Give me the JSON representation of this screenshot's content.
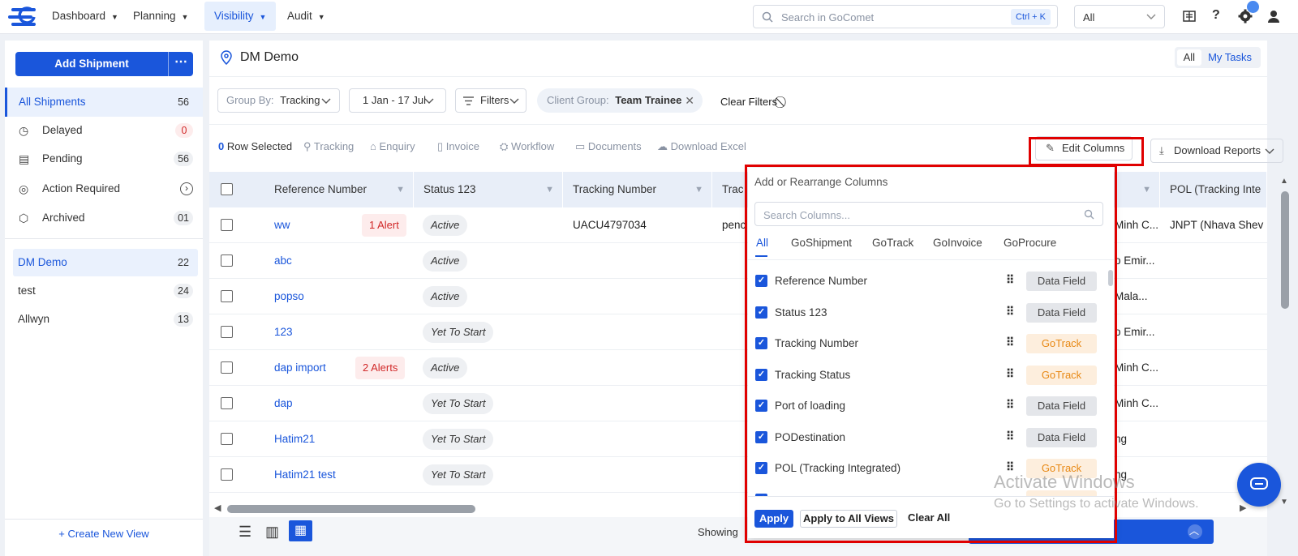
{
  "nav": {
    "items": [
      {
        "label": "Dashboard"
      },
      {
        "label": "Planning"
      },
      {
        "label": "Visibility"
      },
      {
        "label": "Audit"
      }
    ],
    "search_placeholder": "Search in GoComet",
    "search_shortcut": "Ctrl + K",
    "scope_select": "All"
  },
  "sidebar": {
    "add_shipment": "Add Shipment",
    "more": "⋯",
    "items": [
      {
        "label": "All Shipments",
        "count": "56"
      },
      {
        "label": "Delayed",
        "count": "0"
      },
      {
        "label": "Pending",
        "count": "56"
      },
      {
        "label": "Action Required",
        "count": "›"
      },
      {
        "label": "Archived",
        "count": "01"
      }
    ],
    "views": [
      {
        "label": "DM Demo",
        "count": "22"
      },
      {
        "label": "test",
        "count": "24"
      },
      {
        "label": "Allwyn",
        "count": "13"
      }
    ],
    "create_view": "+ Create New View"
  },
  "main": {
    "title": "DM Demo",
    "toggle_all": "All",
    "toggle_mytasks": "My Tasks",
    "group_by_label": "Group By:",
    "group_by_value": "Tracking",
    "date_range": "1 Jan - 17 Jul",
    "filters": "Filters",
    "client_group_label": "Client Group:",
    "client_group_value": "Team Trainee",
    "clear_filters": "Clear Filters",
    "rows_selected_count": "0",
    "rows_selected_label": "Row Selected",
    "actions": [
      "Tracking",
      "Enquiry",
      "Invoice",
      "Workflow",
      "Documents",
      "Download Excel"
    ],
    "edit_columns": "Edit Columns",
    "download_reports": "Download Reports"
  },
  "table": {
    "headers": [
      "Reference Number",
      "Status 123",
      "Tracking Number",
      "Trac",
      "",
      "POL (Tracking Inte"
    ],
    "rows": [
      {
        "ref": "ww",
        "alert": "1 Alert",
        "status": "Active",
        "tracking": "UACU4797034",
        "trac": "penc",
        "col5": "Minh C...",
        "pol": "JNPT (Nhava Shev"
      },
      {
        "ref": "abc",
        "alert": "",
        "status": "Active",
        "tracking": "",
        "trac": "",
        "col5": "o Emir...",
        "pol": ""
      },
      {
        "ref": "popso",
        "alert": "",
        "status": "Active",
        "tracking": "",
        "trac": "",
        "col5": "Mala...",
        "pol": ""
      },
      {
        "ref": "123",
        "alert": "",
        "status": "Yet To Start",
        "tracking": "",
        "trac": "",
        "col5": "o Emir...",
        "pol": ""
      },
      {
        "ref": "dap import",
        "alert": "2 Alerts",
        "status": "Active",
        "tracking": "",
        "trac": "",
        "col5": "Minh C...",
        "pol": ""
      },
      {
        "ref": "dap",
        "alert": "",
        "status": "Yet To Start",
        "tracking": "",
        "trac": "",
        "col5": "Minh C...",
        "pol": ""
      },
      {
        "ref": "Hatim21",
        "alert": "",
        "status": "Yet To Start",
        "tracking": "",
        "trac": "",
        "col5": "ng",
        "pol": ""
      },
      {
        "ref": "Hatim21 test",
        "alert": "",
        "status": "Yet To Start",
        "tracking": "",
        "trac": "",
        "col5": "ng",
        "pol": ""
      }
    ],
    "footer_showing": "Showing"
  },
  "edit_columns_popup": {
    "title": "Add or Rearrange Columns",
    "search_placeholder": "Search Columns...",
    "tabs": [
      "All",
      "GoShipment",
      "GoTrack",
      "GoInvoice",
      "GoProcure"
    ],
    "columns": [
      {
        "name": "Reference Number",
        "tag": "Data Field"
      },
      {
        "name": "Status 123",
        "tag": "Data Field"
      },
      {
        "name": "Tracking Number",
        "tag": "GoTrack"
      },
      {
        "name": "Tracking Status",
        "tag": "GoTrack"
      },
      {
        "name": "Port of loading",
        "tag": "Data Field"
      },
      {
        "name": "PODestination",
        "tag": "Data Field"
      },
      {
        "name": "POL (Tracking Integrated)",
        "tag": "GoTrack"
      }
    ],
    "apply": "Apply",
    "apply_all": "Apply to All Views",
    "clear_all": "Clear All"
  },
  "watermark": {
    "line1": "Activate Windows",
    "line2": "Go to Settings to activate Windows."
  },
  "colors": {
    "accent": "#1a56db",
    "alert": "#d12828",
    "gotrack": "#e88915",
    "highlight": "#e00000"
  }
}
